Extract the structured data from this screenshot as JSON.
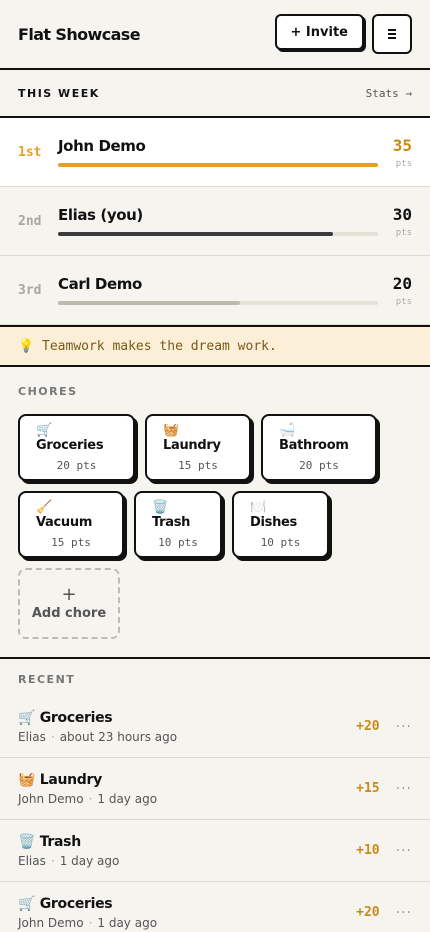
{
  "header": {
    "title": "Flat Showcase",
    "invite_label": "+ Invite",
    "menu_icon": "hamburger-icon"
  },
  "week": {
    "title": "THIS WEEK",
    "stats_label": "Stats →",
    "ranking": [
      {
        "pos": "1st",
        "name": "John Demo",
        "score": "35",
        "unit": "pts",
        "progress": 1.0
      },
      {
        "pos": "2nd",
        "name": "Elias (you)",
        "score": "30",
        "unit": "pts",
        "progress": 0.86
      },
      {
        "pos": "3rd",
        "name": "Carl Demo",
        "score": "20",
        "unit": "pts",
        "progress": 0.57
      }
    ]
  },
  "tip": {
    "icon": "💡",
    "text": "Teamwork makes the dream work."
  },
  "chores": {
    "title": "CHORES",
    "items": [
      {
        "name": "🛒 Groceries",
        "pts": "20 pts"
      },
      {
        "name": "🧺 Laundry",
        "pts": "15 pts"
      },
      {
        "name": "🛁 Bathroom",
        "pts": "20 pts"
      },
      {
        "name": "🧹 Vacuum",
        "pts": "15 pts"
      },
      {
        "name": "🗑️ Trash",
        "pts": "10 pts"
      },
      {
        "name": "🍽️ Dishes",
        "pts": "10 pts"
      }
    ],
    "add_plus": "+",
    "add_label": "Add chore"
  },
  "recent": {
    "title": "RECENT",
    "items": [
      {
        "title": "🛒 Groceries",
        "user": "Elias",
        "time": "about 23 hours ago",
        "pts": "+20"
      },
      {
        "title": "🧺 Laundry",
        "user": "John Demo",
        "time": "1 day ago",
        "pts": "+15"
      },
      {
        "title": "🗑️ Trash",
        "user": "Elias",
        "time": "1 day ago",
        "pts": "+10"
      },
      {
        "title": "🛒 Groceries",
        "user": "John Demo",
        "time": "1 day ago",
        "pts": "+20"
      }
    ],
    "more_label": "···",
    "separator": "·"
  },
  "colors": {
    "accent": "#e3a12a",
    "ink": "#111111",
    "background": "#f6f4ef",
    "tip_bg": "#fbefd7"
  }
}
